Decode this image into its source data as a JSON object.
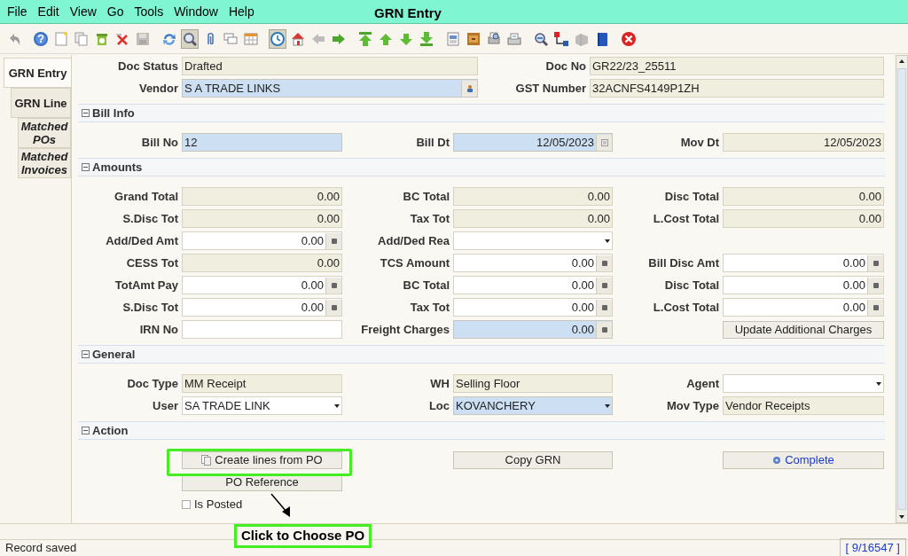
{
  "window": {
    "title": "GRN Entry"
  },
  "menu": [
    "File",
    "Edit",
    "View",
    "Go",
    "Tools",
    "Window",
    "Help"
  ],
  "toolbar": [
    [
      {
        "kind": "undo",
        "disabled": true,
        "pressed": false
      }
    ],
    [
      {
        "kind": "help",
        "disabled": false,
        "pressed": false
      },
      {
        "kind": "new",
        "disabled": false,
        "pressed": false
      },
      {
        "kind": "copy",
        "disabled": false,
        "pressed": false
      },
      {
        "kind": "delete",
        "disabled": false,
        "pressed": false
      },
      {
        "kind": "delete-selected",
        "disabled": false,
        "pressed": false
      },
      {
        "kind": "save",
        "disabled": true,
        "pressed": false
      }
    ],
    [
      {
        "kind": "refresh",
        "disabled": false,
        "pressed": false
      },
      {
        "kind": "find",
        "disabled": false,
        "pressed": true
      },
      {
        "kind": "attach",
        "disabled": false,
        "pressed": false
      },
      {
        "kind": "chat",
        "disabled": false,
        "pressed": false
      },
      {
        "kind": "grid",
        "disabled": false,
        "pressed": false
      }
    ],
    [
      {
        "kind": "history",
        "disabled": false,
        "pressed": true
      },
      {
        "kind": "home",
        "disabled": false,
        "pressed": false
      },
      {
        "kind": "back",
        "disabled": true,
        "pressed": false
      },
      {
        "kind": "forward",
        "disabled": false,
        "pressed": false
      }
    ],
    [
      {
        "kind": "first",
        "disabled": false,
        "pressed": false
      },
      {
        "kind": "up",
        "disabled": false,
        "pressed": false
      },
      {
        "kind": "down",
        "disabled": false,
        "pressed": false
      },
      {
        "kind": "last",
        "disabled": false,
        "pressed": false
      }
    ],
    [
      {
        "kind": "report",
        "disabled": false,
        "pressed": false
      },
      {
        "kind": "archive",
        "disabled": false,
        "pressed": false
      },
      {
        "kind": "preview",
        "disabled": false,
        "pressed": false
      },
      {
        "kind": "print",
        "disabled": false,
        "pressed": false
      }
    ],
    [
      {
        "kind": "zoom",
        "disabled": false,
        "pressed": false
      },
      {
        "kind": "workflow",
        "disabled": false,
        "pressed": false
      },
      {
        "kind": "product",
        "disabled": true,
        "pressed": false
      },
      {
        "kind": "book",
        "disabled": false,
        "pressed": false
      }
    ],
    [
      {
        "kind": "close",
        "disabled": false,
        "pressed": false
      }
    ]
  ],
  "side_tabs": [
    {
      "label": "GRN Entry",
      "selected": true,
      "italic": false
    },
    {
      "label": "GRN Line",
      "selected": false,
      "italic": false
    },
    {
      "label": "Matched POs",
      "selected": false,
      "italic": true
    },
    {
      "label": "Matched Invoices",
      "selected": false,
      "italic": true
    }
  ],
  "header": [
    [
      {
        "label": "Doc Status",
        "value": "Drafted",
        "kind": "text",
        "readonly": true
      },
      {
        "label": "Doc No",
        "value": "GR22/23_25511",
        "kind": "text",
        "readonly": true
      }
    ],
    [
      {
        "label": "Vendor",
        "value": "S A TRADE LINKS",
        "kind": "lookup",
        "readonly": false,
        "mandatory": true
      },
      {
        "label": "GST Number",
        "value": "32ACNFS4149P1ZH",
        "kind": "text",
        "readonly": true
      }
    ]
  ],
  "sections": [
    {
      "title": "Bill Info",
      "expanded": true,
      "rows": [
        [
          {
            "label": "Bill No",
            "value": "12",
            "kind": "text",
            "readonly": false,
            "mandatory": true
          },
          {
            "label": "Bill Dt",
            "value": "12/05/2023",
            "kind": "date",
            "readonly": false,
            "mandatory": true
          },
          {
            "label": "Mov Dt",
            "value": "12/05/2023",
            "kind": "date",
            "readonly": true
          }
        ]
      ]
    },
    {
      "title": "Amounts",
      "expanded": true,
      "rows": [
        [
          {
            "label": "Grand Total",
            "value": "0.00",
            "kind": "amount",
            "readonly": true
          },
          {
            "label": "BC Total",
            "value": "0.00",
            "kind": "amount",
            "readonly": true
          },
          {
            "label": "Disc Total",
            "value": "0.00",
            "kind": "amount",
            "readonly": true
          }
        ],
        [
          {
            "label": "S.Disc Tot",
            "value": "0.00",
            "kind": "amount",
            "readonly": true
          },
          {
            "label": "Tax Tot",
            "value": "0.00",
            "kind": "amount",
            "readonly": true
          },
          {
            "label": "L.Cost Total",
            "value": "0.00",
            "kind": "amount",
            "readonly": true
          }
        ],
        [
          {
            "label": "Add/Ded Amt",
            "value": "0.00",
            "kind": "amount",
            "readonly": false,
            "mandatory": false
          },
          {
            "label": "Add/Ded Rea",
            "kind": "list",
            "readonly": false,
            "mandatory": false
          },
          null
        ],
        [
          {
            "label": "CESS Tot",
            "value": "0.00",
            "kind": "amount",
            "readonly": true
          },
          {
            "label": "TCS Amount",
            "value": "0.00",
            "kind": "amount",
            "readonly": false,
            "mandatory": false
          },
          {
            "label": "Bill Disc Amt",
            "value": "0.00",
            "kind": "amount",
            "readonly": false,
            "mandatory": false
          }
        ],
        [
          {
            "label": "TotAmt Pay",
            "value": "0.00",
            "kind": "amount",
            "readonly": false,
            "mandatory": false
          },
          {
            "label": "BC Total",
            "value": "0.00",
            "kind": "amount",
            "readonly": false,
            "mandatory": false
          },
          {
            "label": "Disc Total",
            "value": "0.00",
            "kind": "amount",
            "readonly": false,
            "mandatory": false
          }
        ],
        [
          {
            "label": "S.Disc Tot",
            "value": "0.00",
            "kind": "amount",
            "readonly": false,
            "mandatory": false
          },
          {
            "label": "Tax Tot",
            "value": "0.00",
            "kind": "amount",
            "readonly": false,
            "mandatory": false
          },
          {
            "label": "L.Cost Total",
            "value": "0.00",
            "kind": "amount",
            "readonly": false,
            "mandatory": false
          }
        ],
        [
          {
            "label": "IRN No",
            "kind": "text",
            "readonly": false,
            "mandatory": false
          },
          {
            "label": "Freight Charges",
            "value": "0.00",
            "kind": "amount",
            "readonly": false,
            "mandatory": true
          },
          {
            "kind": "button",
            "button": "Update Additional Charges"
          }
        ]
      ]
    },
    {
      "title": "General",
      "expanded": true,
      "rows": [
        [
          {
            "label": "Doc Type",
            "value": "MM Receipt",
            "kind": "text",
            "readonly": true
          },
          {
            "label": "WH",
            "value": "Selling Floor",
            "kind": "text",
            "readonly": true
          },
          {
            "label": "Agent",
            "kind": "list",
            "readonly": false,
            "mandatory": false
          }
        ],
        [
          {
            "label": "User",
            "value": "SA TRADE LINK",
            "kind": "list",
            "readonly": false,
            "mandatory": false
          },
          {
            "label": "Loc",
            "value": "KOVANCHERY",
            "kind": "list",
            "readonly": false,
            "mandatory": true
          },
          {
            "label": "Mov Type",
            "value": "Vendor Receipts",
            "kind": "text",
            "readonly": true
          }
        ]
      ]
    },
    {
      "title": "Action",
      "expanded": true,
      "rows": [
        [
          {
            "kind": "create_button",
            "button": "Create lines from PO"
          },
          {
            "kind": "button",
            "button": "Copy GRN"
          },
          {
            "kind": "process_button",
            "button": "Complete"
          }
        ],
        [
          {
            "kind": "button",
            "button": "PO Reference"
          },
          null,
          null
        ],
        [
          {
            "kind": "checkbox",
            "label": "Is Posted",
            "checked": false
          },
          null,
          null
        ]
      ]
    }
  ],
  "annotation": {
    "text": "Click to Choose PO"
  },
  "status_bar": {
    "message": "Record saved",
    "record": "[ 9/16547 ]"
  }
}
